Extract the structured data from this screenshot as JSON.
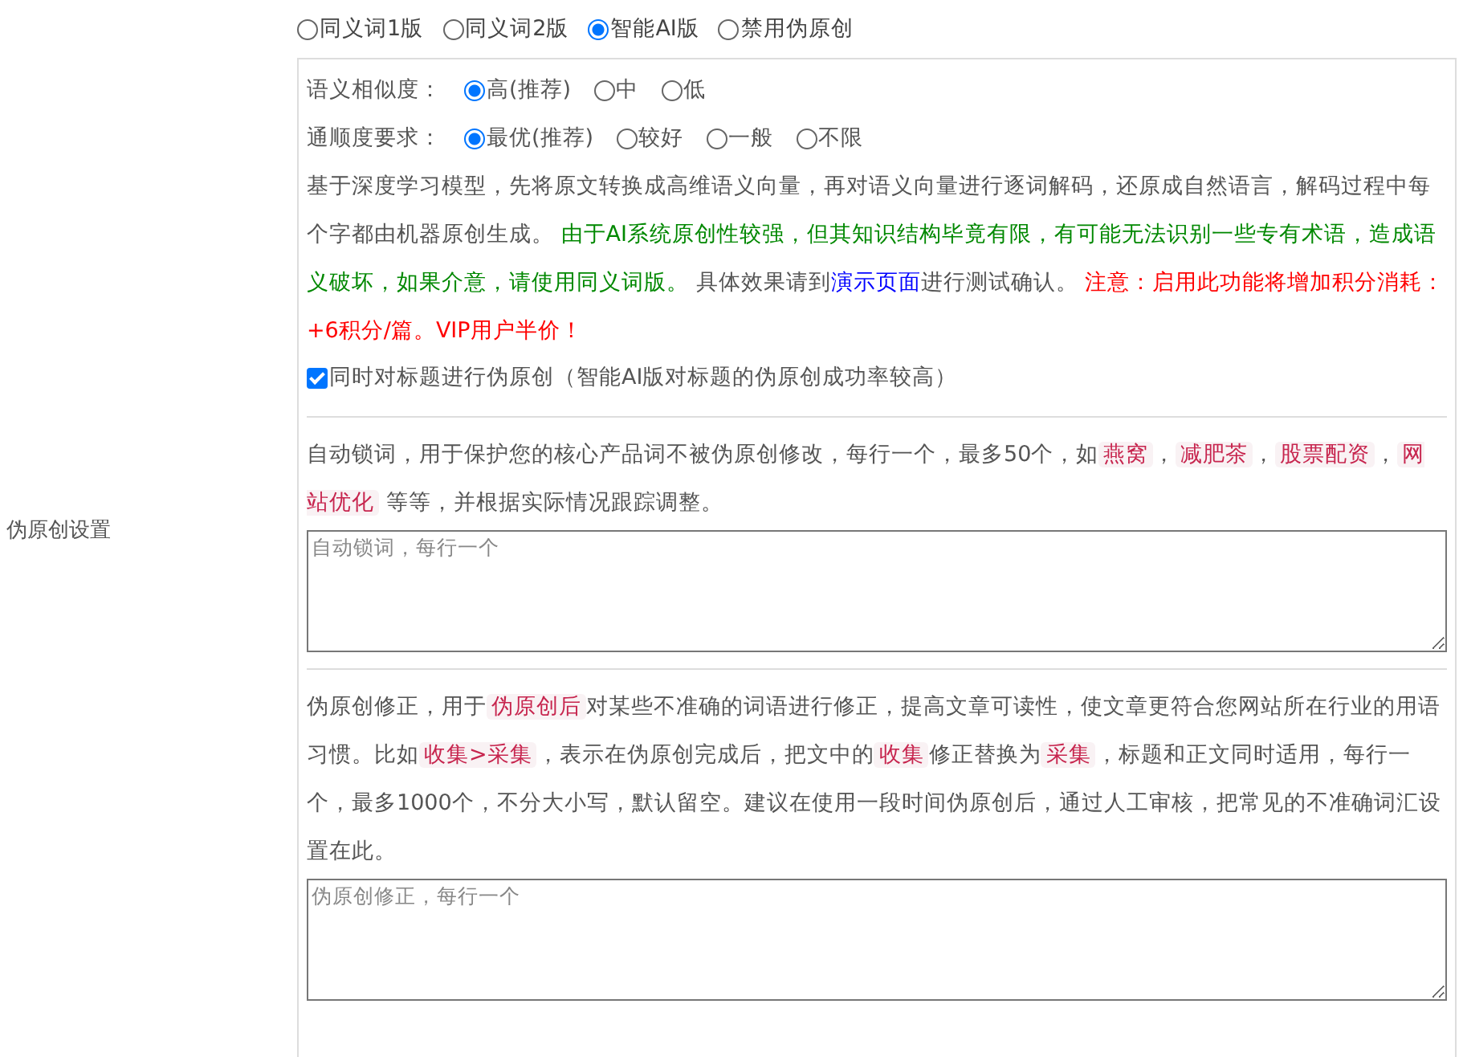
{
  "section_label": "伪原创设置",
  "modes": [
    {
      "label": "同义词1版",
      "selected": false
    },
    {
      "label": "同义词2版",
      "selected": false
    },
    {
      "label": "智能AI版",
      "selected": true
    },
    {
      "label": "禁用伪原创",
      "selected": false
    }
  ],
  "option_groups": [
    {
      "label": "语义相似度：",
      "options": [
        {
          "label": "高(推荐)",
          "selected": true
        },
        {
          "label": "中",
          "selected": false
        },
        {
          "label": "低",
          "selected": false
        }
      ]
    },
    {
      "label": "通顺度要求：",
      "options": [
        {
          "label": "最优(推荐)",
          "selected": true
        },
        {
          "label": "较好",
          "selected": false
        },
        {
          "label": "一般",
          "selected": false
        },
        {
          "label": "不限",
          "selected": false
        }
      ]
    }
  ],
  "ai_note": [
    {
      "kind": "text",
      "text": "基于深度学习模型，先将原文转换成高维语义向量，再对语义向量进行逐词解码，还原成自然语言，解码过程中每个字都由机器原创生成。 "
    },
    {
      "kind": "green",
      "text": "由于AI系统原创性较强，但其知识结构毕竟有限，有可能无法识别一些专有术语，造成语义破坏，如果介意，请使用同义词版。"
    },
    {
      "kind": "text",
      "text": " 具体效果请到"
    },
    {
      "kind": "link",
      "text": "演示页面"
    },
    {
      "kind": "text",
      "text": "进行测试确认。 "
    },
    {
      "kind": "red",
      "text": "注意：启用此功能将增加积分消耗：+6积分/篇。VIP用户半价！"
    }
  ],
  "title_option": {
    "label": "同时对标题进行伪原创（智能AI版对标题的伪原创成功率较高）",
    "checked": true
  },
  "sections": [
    {
      "description": [
        {
          "kind": "text",
          "text": "自动锁词，用于保护您的核心产品词不被伪原创修改，每行一个，最多50个，如"
        },
        {
          "kind": "tag",
          "text": "燕窝"
        },
        {
          "kind": "text",
          "text": "，"
        },
        {
          "kind": "tag",
          "text": "减肥茶"
        },
        {
          "kind": "text",
          "text": "，"
        },
        {
          "kind": "tag",
          "text": "股票配资"
        },
        {
          "kind": "text",
          "text": "，"
        },
        {
          "kind": "tag",
          "text": "网站优化"
        },
        {
          "kind": "text",
          "text": " 等等，并根据实际情况跟踪调整。"
        }
      ],
      "placeholder": "自动锁词，每行一个"
    },
    {
      "description": [
        {
          "kind": "text",
          "text": "伪原创修正，用于"
        },
        {
          "kind": "tag",
          "text": "伪原创后"
        },
        {
          "kind": "text",
          "text": "对某些不准确的词语进行修正，提高文章可读性，使文章更符合您网站所在行业的用语习惯。比如"
        },
        {
          "kind": "tag",
          "text": "收集>采集"
        },
        {
          "kind": "text",
          "text": "，表示在伪原创完成后，把文中的"
        },
        {
          "kind": "tag",
          "text": "收集"
        },
        {
          "kind": "text",
          "text": "修正替换为"
        },
        {
          "kind": "tag",
          "text": "采集"
        },
        {
          "kind": "text",
          "text": "，标题和正文同时适用，每行一个，最多1000个，不分大小写，默认留空。建议在使用一段时间伪原创后，通过人工审核，把常见的不准确词汇设置在此。"
        }
      ],
      "placeholder": "伪原创修正，每行一个"
    }
  ]
}
